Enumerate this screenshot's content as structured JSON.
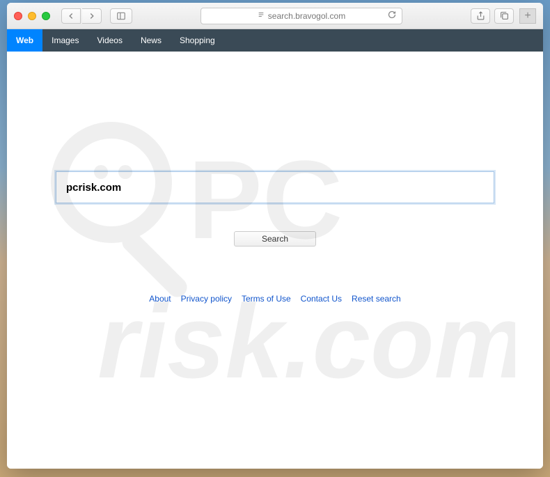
{
  "browser": {
    "url": "search.bravogol.com"
  },
  "nav": {
    "tabs": [
      {
        "label": "Web",
        "active": true
      },
      {
        "label": "Images",
        "active": false
      },
      {
        "label": "Videos",
        "active": false
      },
      {
        "label": "News",
        "active": false
      },
      {
        "label": "Shopping",
        "active": false
      }
    ]
  },
  "search": {
    "value": "pcrisk.com",
    "button_label": "Search"
  },
  "footer": {
    "links": [
      "About",
      "Privacy policy",
      "Terms of Use",
      "Contact Us",
      "Reset search"
    ]
  }
}
